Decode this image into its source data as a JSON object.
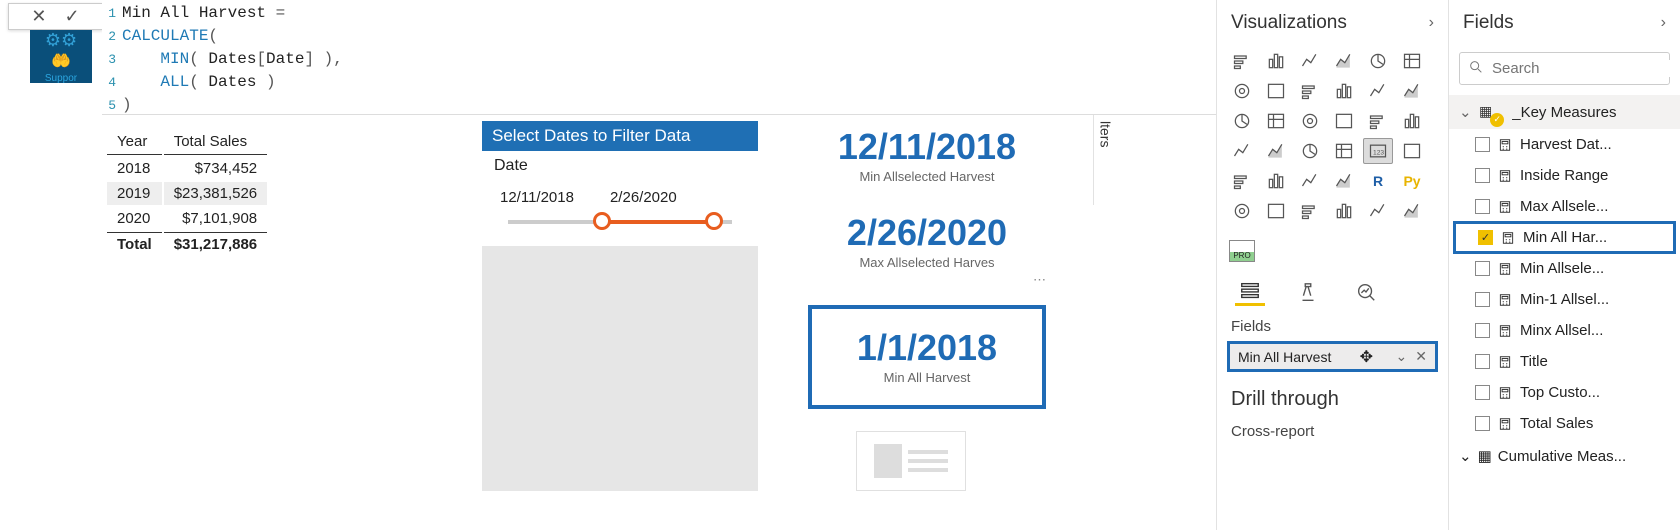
{
  "formula": {
    "lines": [
      {
        "n": "1",
        "parts": [
          [
            "kw-measure",
            "Min All Harvest "
          ],
          [
            "kw-punc",
            "="
          ]
        ]
      },
      {
        "n": "2",
        "parts": [
          [
            "kw-func",
            "CALCULATE"
          ],
          [
            "kw-punc",
            "("
          ]
        ]
      },
      {
        "n": "3",
        "parts": [
          [
            "kw-measure",
            "    "
          ],
          [
            "kw-func",
            "MIN"
          ],
          [
            "kw-punc",
            "( "
          ],
          [
            "kw-measure",
            "Dates"
          ],
          [
            "kw-punc",
            "["
          ],
          [
            "kw-measure",
            "Date"
          ],
          [
            "kw-punc",
            "] ),"
          ]
        ]
      },
      {
        "n": "4",
        "parts": [
          [
            "kw-measure",
            "    "
          ],
          [
            "kw-func",
            "ALL"
          ],
          [
            "kw-punc",
            "( "
          ],
          [
            "kw-measure",
            "Dates"
          ],
          [
            "kw-punc",
            " )"
          ]
        ]
      },
      {
        "n": "5",
        "parts": [
          [
            "kw-punc",
            ")"
          ]
        ]
      }
    ]
  },
  "logo_text": "Suppor",
  "table": {
    "headers": [
      "Year",
      "Total Sales"
    ],
    "rows": [
      {
        "year": "2018",
        "sales": "$734,452",
        "alt": false
      },
      {
        "year": "2019",
        "sales": "$23,381,526",
        "alt": true
      },
      {
        "year": "2020",
        "sales": "$7,101,908",
        "alt": false
      }
    ],
    "total": {
      "label": "Total",
      "sales": "$31,217,886"
    }
  },
  "slicer": {
    "title": "Select Dates to Filter Data",
    "field": "Date",
    "from": "12/11/2018",
    "to": "2/26/2020"
  },
  "cards": {
    "c1": {
      "value": "12/11/2018",
      "caption": "Min Allselected Harvest"
    },
    "c2": {
      "value": "2/26/2020",
      "caption": "Max Allselected Harves"
    },
    "c3": {
      "value": "1/1/2018",
      "caption": "Min All Harvest"
    }
  },
  "filters_label": "lters",
  "viz": {
    "title": "Visualizations",
    "pro": "PRO",
    "fields_label": "Fields",
    "well_field": "Min All Harvest",
    "drill_label": "Drill through",
    "cross_label": "Cross-report"
  },
  "fields": {
    "title": "Fields",
    "search_placeholder": "Search",
    "table1": "_Key Measures",
    "items": [
      {
        "label": "Harvest Dat...",
        "checked": false
      },
      {
        "label": "Inside Range",
        "checked": false
      },
      {
        "label": "Max Allsele...",
        "checked": false
      },
      {
        "label": "Min All Har...",
        "checked": true,
        "selected": true
      },
      {
        "label": "Min Allsele...",
        "checked": false
      },
      {
        "label": "Min-1 Allsel...",
        "checked": false
      },
      {
        "label": "Minx Allsel...",
        "checked": false
      },
      {
        "label": "Title",
        "checked": false
      },
      {
        "label": "Top Custo...",
        "checked": false
      },
      {
        "label": "Total Sales",
        "checked": false
      }
    ],
    "table2": "Cumulative Meas..."
  }
}
